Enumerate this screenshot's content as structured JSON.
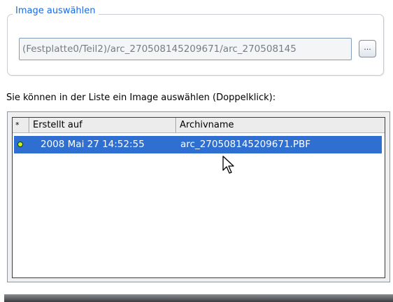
{
  "group": {
    "title": "Image auswählen"
  },
  "path": {
    "value": "(Festplatte0/Teil2)/arc_270508145209671/arc_270508145"
  },
  "browse": {
    "label": "..."
  },
  "hint": {
    "text": "Sie können in der Liste ein Image auswählen (Doppelklick):"
  },
  "list": {
    "columns": [
      "*",
      "Erstellt auf",
      "Archivname"
    ],
    "rows": [
      {
        "date": "2008 Mai 27 14:52:55",
        "name": "arc_270508145209671.PBF",
        "selected": true
      }
    ]
  },
  "colors": {
    "accent": "#1a6be0",
    "selection": "#2f6fd2",
    "status": "#c9f21c"
  },
  "icons": {
    "status": "status-dot-icon",
    "cursor": "mouse-pointer-icon"
  }
}
